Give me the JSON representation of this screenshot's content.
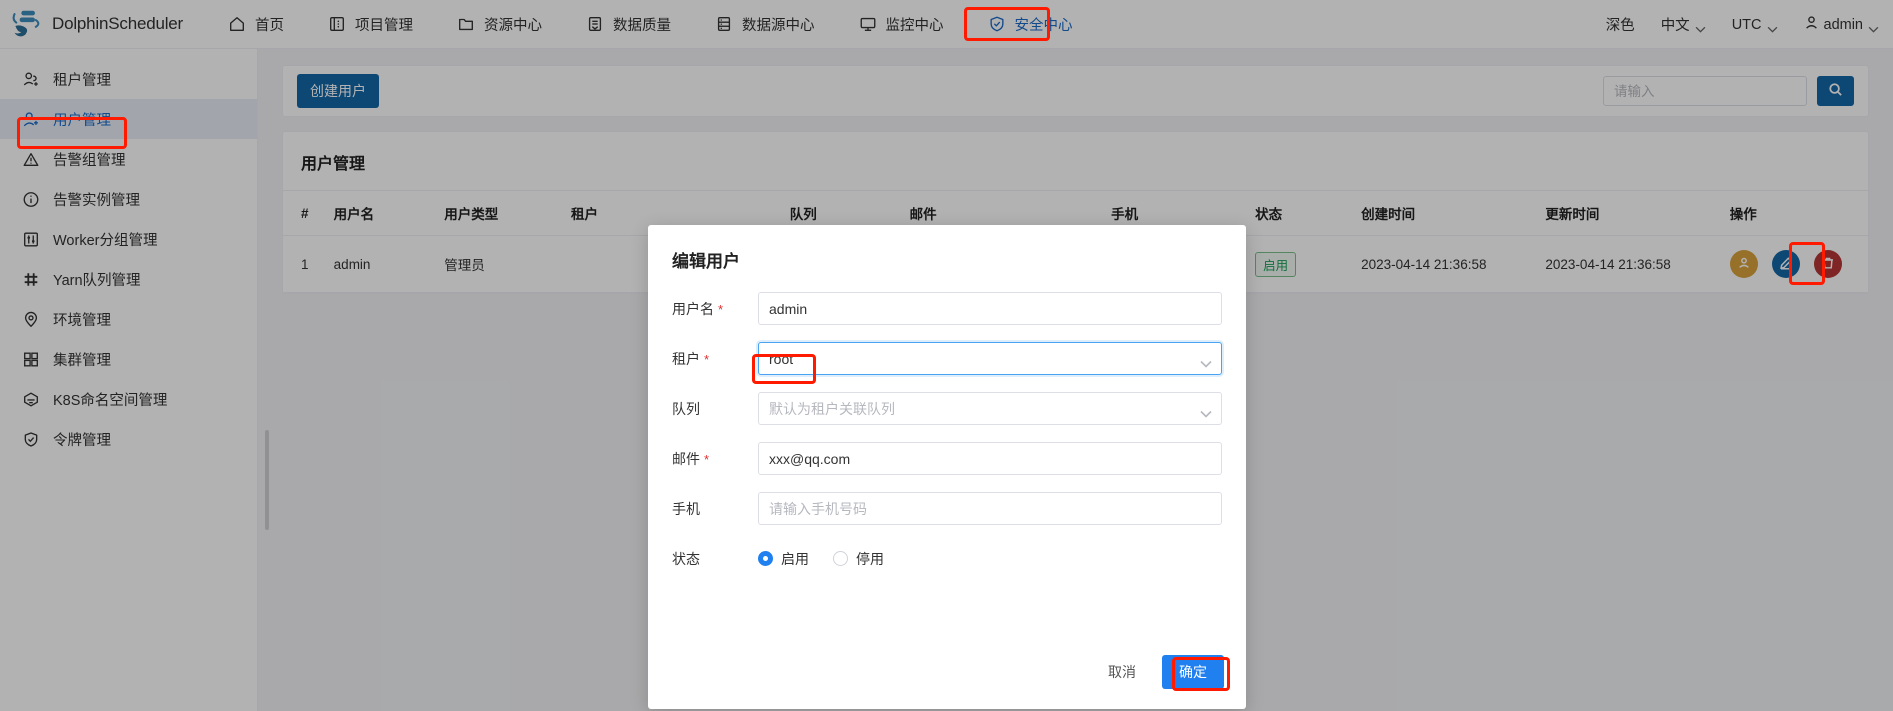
{
  "header": {
    "brand": "DolphinScheduler",
    "nav": [
      {
        "label": "首页",
        "icon": "home-icon",
        "active": false
      },
      {
        "label": "项目管理",
        "icon": "project-icon",
        "active": false
      },
      {
        "label": "资源中心",
        "icon": "folder-icon",
        "active": false
      },
      {
        "label": "数据质量",
        "icon": "quality-icon",
        "active": false
      },
      {
        "label": "数据源中心",
        "icon": "database-icon",
        "active": false
      },
      {
        "label": "监控中心",
        "icon": "monitor-icon",
        "active": false
      },
      {
        "label": "安全中心",
        "icon": "shield-icon",
        "active": true
      }
    ],
    "theme": "深色",
    "language": "中文",
    "timezone": "UTC",
    "user": "admin"
  },
  "sidebar": {
    "items": [
      {
        "label": "租户管理",
        "icon": "tenant-icon",
        "active": false
      },
      {
        "label": "用户管理",
        "icon": "user-icon",
        "active": true
      },
      {
        "label": "告警组管理",
        "icon": "warning-icon",
        "active": false
      },
      {
        "label": "告警实例管理",
        "icon": "info-icon",
        "active": false
      },
      {
        "label": "Worker分组管理",
        "icon": "sliders-icon",
        "active": false
      },
      {
        "label": "Yarn队列管理",
        "icon": "yarn-icon",
        "active": false
      },
      {
        "label": "环境管理",
        "icon": "location-icon",
        "active": false
      },
      {
        "label": "集群管理",
        "icon": "cluster-icon",
        "active": false
      },
      {
        "label": "K8S命名空间管理",
        "icon": "k8s-icon",
        "active": false
      },
      {
        "label": "令牌管理",
        "icon": "token-shield-icon",
        "active": false
      }
    ]
  },
  "toolbar": {
    "create_label": "创建用户",
    "search_placeholder": "请输入",
    "search_value": ""
  },
  "panel": {
    "title": "用户管理",
    "columns": [
      "#",
      "用户名",
      "用户类型",
      "租户",
      "队列",
      "邮件",
      "手机",
      "状态",
      "创建时间",
      "更新时间",
      "操作"
    ],
    "rows": [
      {
        "index": "1",
        "username": "admin",
        "user_type": "管理员",
        "tenant": "",
        "queue": "",
        "email": "",
        "phone": "",
        "status": "启用",
        "create_time": "2023-04-14 21:36:58",
        "update_time": "2023-04-14 21:36:58",
        "actions": [
          "authorize-icon",
          "edit-icon",
          "delete-icon"
        ]
      }
    ]
  },
  "modal": {
    "title": "编辑用户",
    "fields": {
      "username_label": "用户名",
      "username_value": "admin",
      "tenant_label": "租户",
      "tenant_value": "root",
      "queue_label": "队列",
      "queue_placeholder": "默认为租户关联队列",
      "email_label": "邮件",
      "email_value": "xxx@qq.com",
      "phone_label": "手机",
      "phone_placeholder": "请输入手机号码",
      "status_label": "状态",
      "status_enable": "启用",
      "status_disable": "停用"
    },
    "cancel_label": "取消",
    "confirm_label": "确定"
  },
  "colors": {
    "primary": "#1468a8",
    "accent": "#2080f0",
    "annotation": "#ff1a00",
    "status_green": "#18a058",
    "action_orange": "#d9a13b",
    "action_blue": "#1468a8",
    "action_red": "#b63535"
  }
}
